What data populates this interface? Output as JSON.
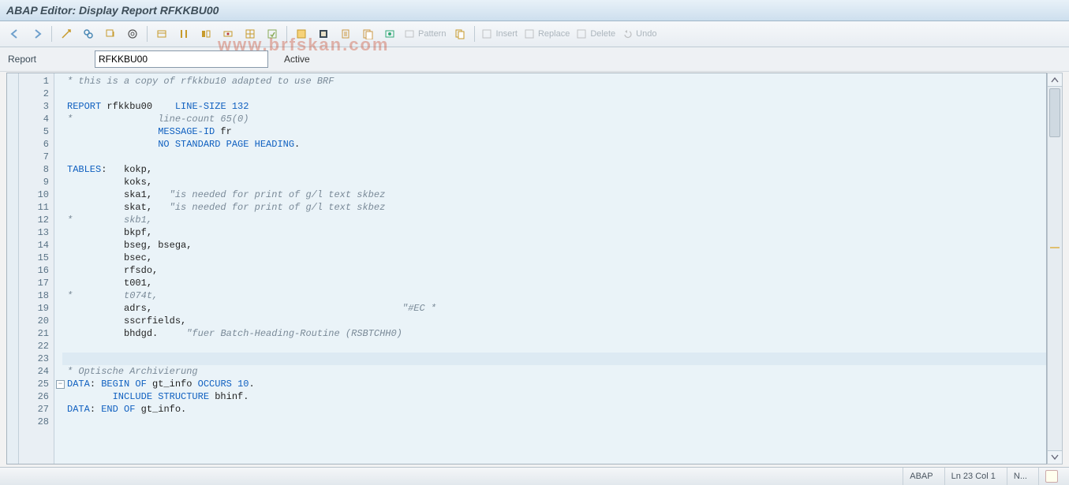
{
  "title": "ABAP Editor: Display Report RFKKBU00",
  "toolbar": {
    "pattern": "Pattern",
    "insert": "Insert",
    "replace": "Replace",
    "delete": "Delete",
    "undo": "Undo"
  },
  "subbar": {
    "label": "Report",
    "value": "RFKKBU00",
    "status": "Active"
  },
  "watermark": "www.brfskan.com",
  "code": {
    "total_lines_shown": 28,
    "current_line_index": 23,
    "lines": [
      {
        "n": 1,
        "tokens": [
          [
            "cmt",
            "* this is a copy of rfkkbu10 adapted to use BRF"
          ]
        ]
      },
      {
        "n": 2,
        "tokens": []
      },
      {
        "n": 3,
        "tokens": [
          [
            "kw",
            "REPORT"
          ],
          [
            "txt",
            " rfkkbu00    "
          ],
          [
            "kw",
            "LINE-SIZE"
          ],
          [
            "txt",
            " "
          ],
          [
            "num",
            "132"
          ]
        ]
      },
      {
        "n": 4,
        "tokens": [
          [
            "cmt",
            "*               line-count 65(0)"
          ]
        ]
      },
      {
        "n": 5,
        "tokens": [
          [
            "txt",
            "                "
          ],
          [
            "kw",
            "MESSAGE-ID"
          ],
          [
            "txt",
            " fr"
          ]
        ]
      },
      {
        "n": 6,
        "tokens": [
          [
            "txt",
            "                "
          ],
          [
            "kw",
            "NO STANDARD PAGE HEADING"
          ],
          [
            "txt",
            "."
          ]
        ]
      },
      {
        "n": 7,
        "tokens": []
      },
      {
        "n": 8,
        "tokens": [
          [
            "kw",
            "TABLES"
          ],
          [
            "txt",
            ":   kokp,"
          ]
        ]
      },
      {
        "n": 9,
        "tokens": [
          [
            "txt",
            "          koks,"
          ]
        ]
      },
      {
        "n": 10,
        "tokens": [
          [
            "txt",
            "          ska1,   "
          ],
          [
            "cmt",
            "\"is needed for print of g/l text skbez"
          ]
        ]
      },
      {
        "n": 11,
        "tokens": [
          [
            "txt",
            "          skat,   "
          ],
          [
            "cmt",
            "\"is needed for print of g/l text skbez"
          ]
        ]
      },
      {
        "n": 12,
        "tokens": [
          [
            "cmt",
            "*         skb1,"
          ]
        ]
      },
      {
        "n": 13,
        "tokens": [
          [
            "txt",
            "          bkpf,"
          ]
        ]
      },
      {
        "n": 14,
        "tokens": [
          [
            "txt",
            "          bseg, bsega,"
          ]
        ]
      },
      {
        "n": 15,
        "tokens": [
          [
            "txt",
            "          bsec,"
          ]
        ]
      },
      {
        "n": 16,
        "tokens": [
          [
            "txt",
            "          rfsdo,"
          ]
        ]
      },
      {
        "n": 17,
        "tokens": [
          [
            "txt",
            "          t001,"
          ]
        ]
      },
      {
        "n": 18,
        "tokens": [
          [
            "cmt",
            "*         t074t,"
          ]
        ]
      },
      {
        "n": 19,
        "tokens": [
          [
            "txt",
            "          adrs,                                            "
          ],
          [
            "cmt",
            "\"#EC *"
          ]
        ]
      },
      {
        "n": 20,
        "tokens": [
          [
            "txt",
            "          sscrfields,"
          ]
        ]
      },
      {
        "n": 21,
        "tokens": [
          [
            "txt",
            "          bhdgd.     "
          ],
          [
            "cmt",
            "\"fuer Batch-Heading-Routine (RSBTCHH0)"
          ]
        ]
      },
      {
        "n": 22,
        "tokens": []
      },
      {
        "n": 23,
        "tokens": [],
        "current": true
      },
      {
        "n": 24,
        "tokens": [
          [
            "cmt",
            "* Optische Archivierung"
          ]
        ]
      },
      {
        "n": 25,
        "tokens": [
          [
            "kw",
            "DATA"
          ],
          [
            "txt",
            ": "
          ],
          [
            "kw",
            "BEGIN OF"
          ],
          [
            "txt",
            " gt_info "
          ],
          [
            "kw",
            "OCCURS"
          ],
          [
            "txt",
            " "
          ],
          [
            "num",
            "10"
          ],
          [
            "txt",
            "."
          ]
        ],
        "fold": "open"
      },
      {
        "n": 26,
        "tokens": [
          [
            "txt",
            "        "
          ],
          [
            "kw",
            "INCLUDE STRUCTURE"
          ],
          [
            "txt",
            " bhinf."
          ]
        ]
      },
      {
        "n": 27,
        "tokens": [
          [
            "kw",
            "DATA"
          ],
          [
            "txt",
            ": "
          ],
          [
            "kw",
            "END OF"
          ],
          [
            "txt",
            " gt_info."
          ]
        ]
      },
      {
        "n": 28,
        "tokens": []
      }
    ]
  },
  "status": {
    "lang": "ABAP",
    "pos": "Ln  23 Col  1",
    "mode": "N..."
  }
}
